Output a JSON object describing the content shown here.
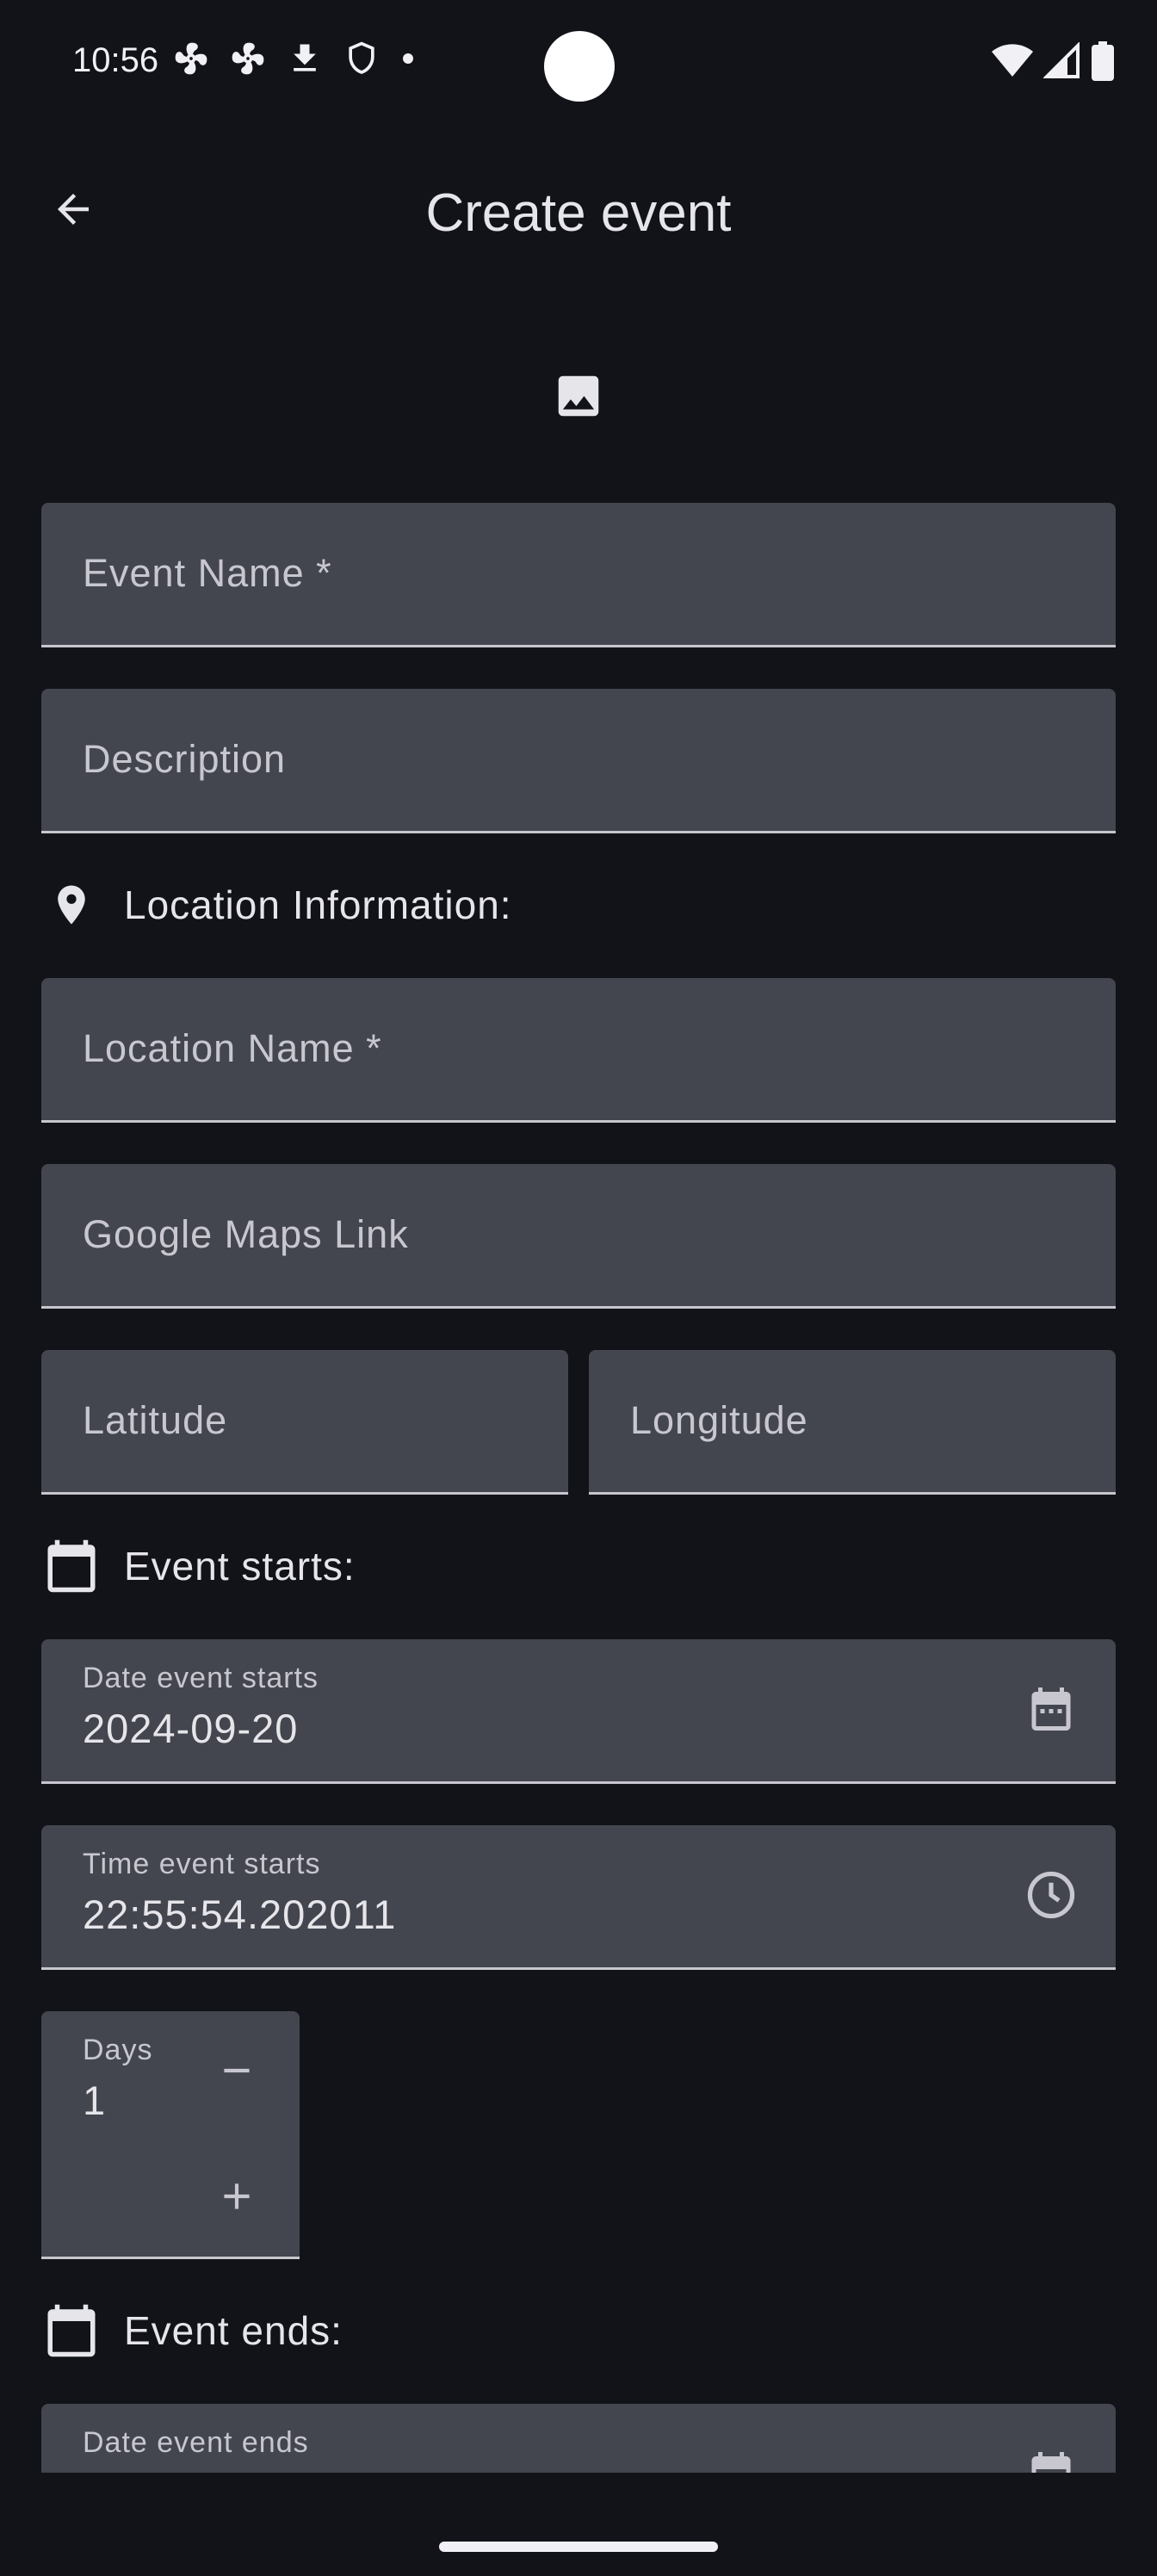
{
  "status_bar": {
    "time": "10:56",
    "left_icons": [
      "fan-icon",
      "fan-icon",
      "download-icon",
      "shield-icon",
      "dot-icon"
    ],
    "right_icons": [
      "wifi-icon",
      "signal-icon",
      "battery-icon"
    ]
  },
  "app_bar": {
    "title": "Create event",
    "back_icon": "arrow-back-icon"
  },
  "image_button_icon": "image-icon",
  "fields": {
    "event_name": {
      "placeholder": "Event Name *"
    },
    "description": {
      "placeholder": "Description"
    },
    "location_name": {
      "placeholder": "Location Name *"
    },
    "maps_link": {
      "placeholder": "Google Maps Link"
    },
    "latitude": {
      "placeholder": "Latitude"
    },
    "longitude": {
      "placeholder": "Longitude"
    },
    "date_start": {
      "label": "Date event starts",
      "value": "2024-09-20",
      "icon": "calendar-icon"
    },
    "time_start": {
      "label": "Time event starts",
      "value": "22:55:54.202011",
      "icon": "clock-icon"
    },
    "days": {
      "label": "Days",
      "value": "1"
    },
    "date_end": {
      "label": "Date event ends",
      "icon": "calendar-icon"
    }
  },
  "sections": {
    "location": {
      "label": "Location Information:",
      "icon": "location-pin-icon"
    },
    "starts": {
      "label": "Event starts:",
      "icon": "calendar-icon"
    },
    "ends": {
      "label": "Event ends:",
      "icon": "calendar-icon"
    }
  },
  "colors": {
    "background": "#111318",
    "field": "#44464f",
    "text": "#e6e5ea"
  }
}
